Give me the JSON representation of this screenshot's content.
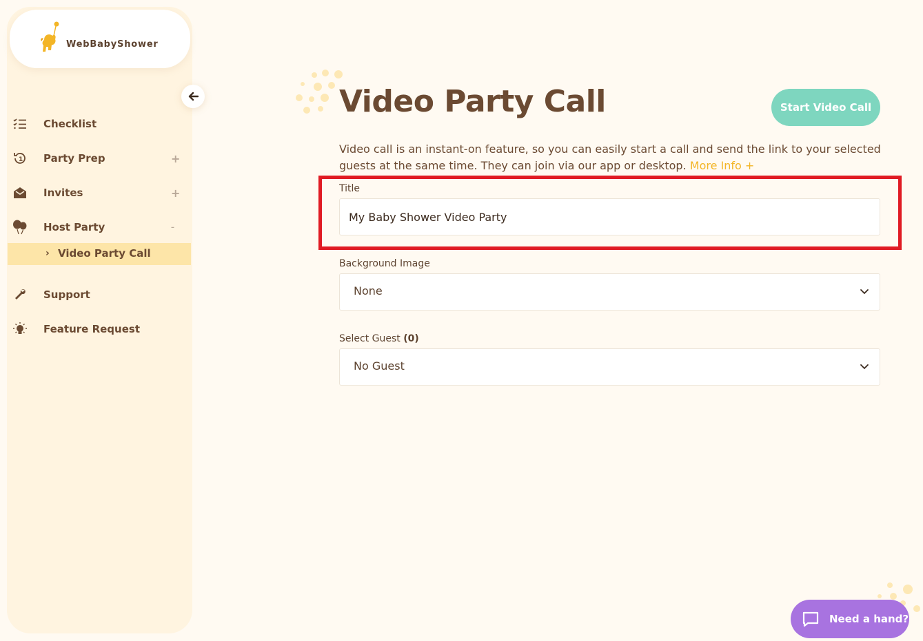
{
  "brand": {
    "name": "WebBabyShower",
    "accent": "#f3b526"
  },
  "sidebar": {
    "items": [
      {
        "label": "Checklist",
        "icon": "checklist-icon"
      },
      {
        "label": "Party Prep",
        "icon": "history-icon",
        "expand": "+"
      },
      {
        "label": "Invites",
        "icon": "envelope-icon",
        "expand": "+"
      },
      {
        "label": "Host Party",
        "icon": "balloons-icon",
        "expand": "–"
      },
      {
        "label": "Support",
        "icon": "wrench-icon"
      },
      {
        "label": "Feature Request",
        "icon": "lightbulb-icon"
      }
    ],
    "sub_item": {
      "label": "Video Party Call",
      "chevron": "›"
    }
  },
  "main": {
    "title": "Video Party Call",
    "start_button": "Start Video Call",
    "description": "Video call is an instant-on feature, so you can easily start a call and send the link to your selected guests at the same time. They can join via our app or desktop.",
    "more_info": "More Info +",
    "title_field": {
      "label": "Title",
      "value": "My Baby Shower Video Party"
    },
    "background_field": {
      "label": "Background Image",
      "value": "None"
    },
    "guest_field": {
      "label": "Select Guest",
      "count": "(0)",
      "value": "No Guest"
    }
  },
  "help": {
    "label": "Need a hand?"
  }
}
